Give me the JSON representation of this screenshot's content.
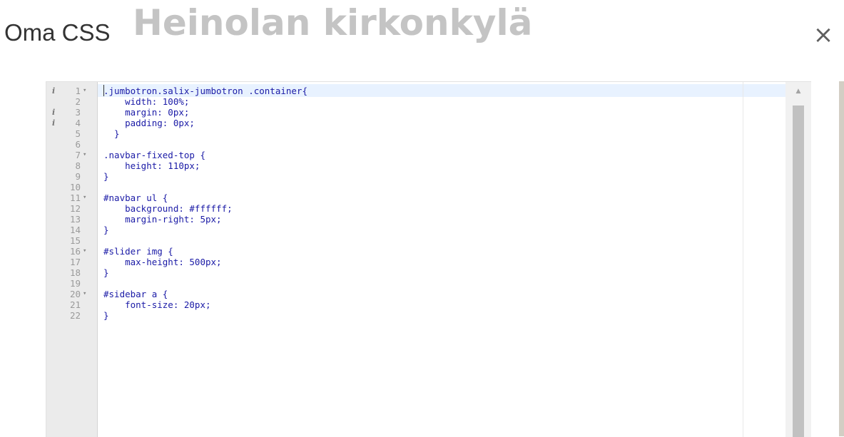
{
  "background_site_title": "Heinolan kirkonkylä",
  "modal": {
    "title": "Oma CSS",
    "close_symbol": "×"
  },
  "editor": {
    "lines": [
      {
        "n": "1",
        "fold": true,
        "info": true,
        "text": ".jumbotron.salix-jumbotron .container{"
      },
      {
        "n": "2",
        "fold": false,
        "info": false,
        "text": "    width: 100%;"
      },
      {
        "n": "3",
        "fold": false,
        "info": true,
        "text": "    margin: 0px;"
      },
      {
        "n": "4",
        "fold": false,
        "info": true,
        "text": "    padding: 0px;"
      },
      {
        "n": "5",
        "fold": false,
        "info": false,
        "text": "  }"
      },
      {
        "n": "6",
        "fold": false,
        "info": false,
        "text": ""
      },
      {
        "n": "7",
        "fold": true,
        "info": false,
        "text": ".navbar-fixed-top {"
      },
      {
        "n": "8",
        "fold": false,
        "info": false,
        "text": "    height: 110px;"
      },
      {
        "n": "9",
        "fold": false,
        "info": false,
        "text": "}"
      },
      {
        "n": "10",
        "fold": false,
        "info": false,
        "text": ""
      },
      {
        "n": "11",
        "fold": true,
        "info": false,
        "text": "#navbar ul {"
      },
      {
        "n": "12",
        "fold": false,
        "info": false,
        "text": "    background: #ffffff;"
      },
      {
        "n": "13",
        "fold": false,
        "info": false,
        "text": "    margin-right: 5px;"
      },
      {
        "n": "14",
        "fold": false,
        "info": false,
        "text": "}"
      },
      {
        "n": "15",
        "fold": false,
        "info": false,
        "text": ""
      },
      {
        "n": "16",
        "fold": true,
        "info": false,
        "text": "#slider img {"
      },
      {
        "n": "17",
        "fold": false,
        "info": false,
        "text": "    max-height: 500px;"
      },
      {
        "n": "18",
        "fold": false,
        "info": false,
        "text": "}"
      },
      {
        "n": "19",
        "fold": false,
        "info": false,
        "text": ""
      },
      {
        "n": "20",
        "fold": true,
        "info": false,
        "text": "#sidebar a {"
      },
      {
        "n": "21",
        "fold": false,
        "info": false,
        "text": "    font-size: 20px;"
      },
      {
        "n": "22",
        "fold": false,
        "info": false,
        "text": "}"
      }
    ],
    "info_symbol": "i",
    "fold_symbol": "▾",
    "scroll_up_symbol": "▲"
  }
}
